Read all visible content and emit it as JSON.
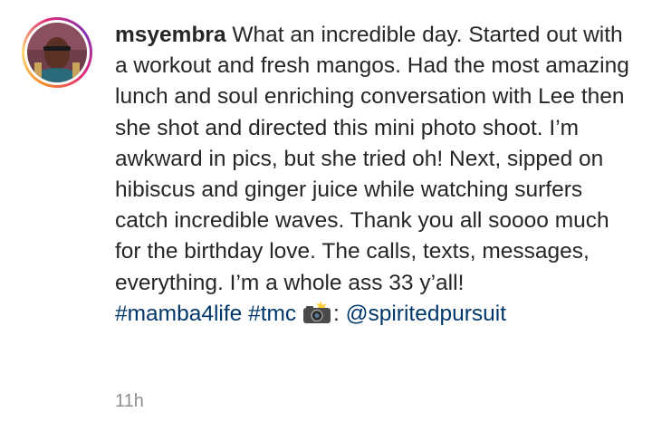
{
  "comment": {
    "username": "msyembra",
    "text": "What an incredible day. Started out with a workout and fresh mangos. Had the most amazing lunch and soul enriching conversation with Lee then she shot and directed this mini photo shoot. I’m awkward in pics, but she tried oh! Next, sipped on hibiscus and ginger juice while watching surfers catch incredible waves. Thank you all soooo much for the birthday love. The calls, texts, messages, everything. I’m a whole ass 33 y’all!",
    "hashtags": [
      "#mamba4life",
      "#tmc"
    ],
    "camera_icon": "camera-with-flash-emoji",
    "mention_separator": ":",
    "mention": "@spiritedpursuit",
    "time_ago": "11h"
  },
  "colors": {
    "text": "#262626",
    "link": "#00376b",
    "meta": "#8e8e8e"
  }
}
